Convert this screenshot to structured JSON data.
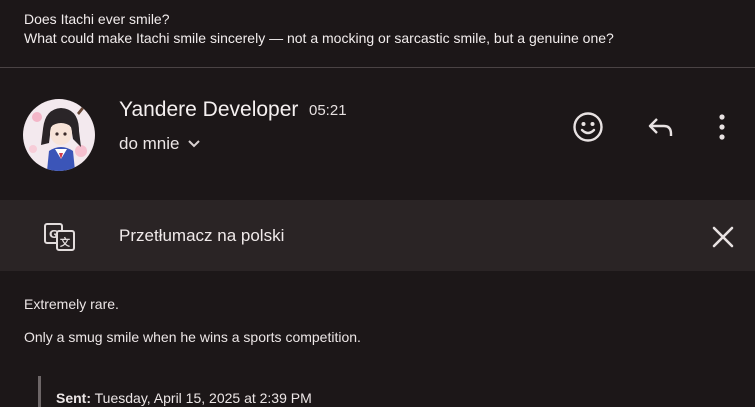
{
  "quoted": {
    "line1": "Does Itachi ever smile?",
    "line2": "What could make Itachi smile sincerely — not a mocking or sarcastic smile, but a genuine one?"
  },
  "header": {
    "sender": "Yandere Developer",
    "time": "05:21",
    "recipient": "do mnie",
    "icons": [
      "emoji-icon",
      "reply-icon",
      "more-vert-icon"
    ]
  },
  "translate": {
    "label": "Przetłumacz na polski",
    "icon": "translate-icon",
    "close_icon": "close-icon"
  },
  "message": {
    "line1": "Extremely rare.",
    "line2": "Only a smug smile when he wins a sports competition."
  },
  "sent": {
    "label": "Sent:",
    "value": "Tuesday, April 15, 2025 at 2:39 PM"
  },
  "colors": {
    "background": "#1c1718",
    "translate_bar": "#2a2425",
    "text": "#ece6e6"
  }
}
